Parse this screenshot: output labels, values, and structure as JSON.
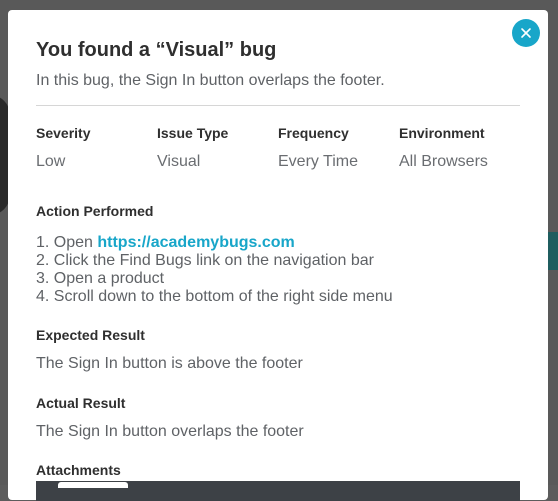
{
  "modal": {
    "title": "You found a “Visual” bug",
    "subtitle": "In this bug, the Sign In button overlaps the footer.",
    "close_icon": "close-icon",
    "accent_color": "#18a6c9"
  },
  "meta": [
    {
      "label": "Severity",
      "value": "Low"
    },
    {
      "label": "Issue Type",
      "value": "Visual"
    },
    {
      "label": "Frequency",
      "value": "Every Time"
    },
    {
      "label": "Environment",
      "value": "All Browsers"
    }
  ],
  "action": {
    "heading": "Action Performed",
    "steps": [
      {
        "prefix": "1. Open ",
        "link": "https://academybugs.com"
      },
      {
        "text": "2. Click the Find Bugs link on the navigation bar"
      },
      {
        "text": "3. Open a product"
      },
      {
        "text": "4. Scroll down to the bottom of the right side menu"
      }
    ]
  },
  "expected": {
    "heading": "Expected Result",
    "text": "The Sign In button is above the footer"
  },
  "actual": {
    "heading": "Actual Result",
    "text": "The Sign In button overlaps the footer"
  },
  "attachments": {
    "heading": "Attachments"
  }
}
